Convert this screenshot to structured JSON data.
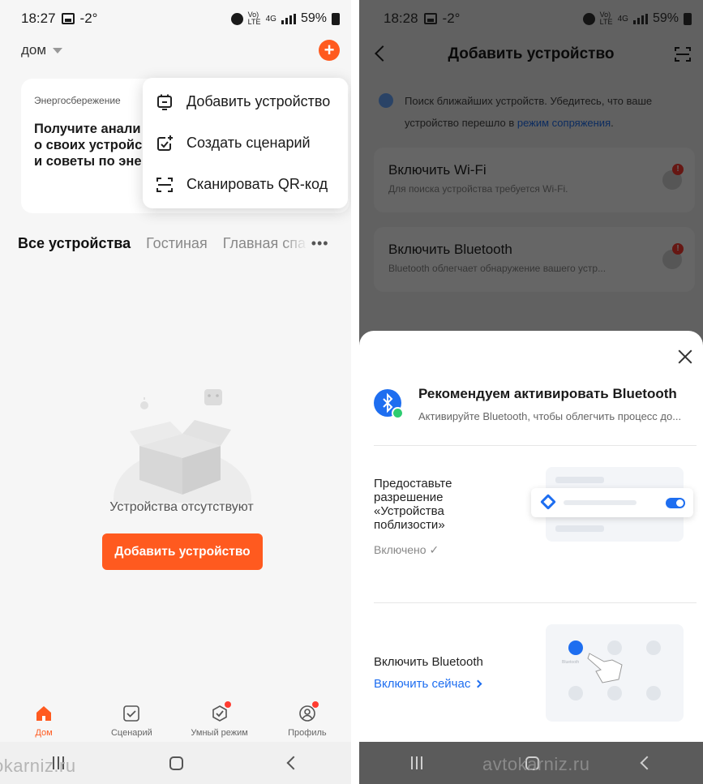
{
  "left": {
    "status": {
      "time": "18:27",
      "temp": "-2°",
      "battery": "59%",
      "net_top": "Vo)",
      "net_bottom": "LTE",
      "signal": "4G"
    },
    "home": {
      "label": "дом"
    },
    "energy_card": {
      "tag": "Энергосбережение",
      "title_lines": [
        "Получите анали",
        "о своих устройс",
        "и советы по эне"
      ]
    },
    "menu": {
      "items": [
        {
          "label": "Добавить устройство",
          "icon": "add-device-icon"
        },
        {
          "label": "Создать сценарий",
          "icon": "create-scene-icon"
        },
        {
          "label": "Сканировать QR-код",
          "icon": "qr-scan-icon"
        }
      ]
    },
    "rooms": {
      "active": "Все устройства",
      "tabs": [
        "Гостиная",
        "Главная спа"
      ],
      "more": "•••"
    },
    "empty": {
      "text": "Устройства отсутствуют",
      "button": "Добавить устройство"
    },
    "tabbar": {
      "items": [
        {
          "label": "Дом",
          "icon": "home-icon",
          "active": true,
          "badge": false
        },
        {
          "label": "Сценарий",
          "icon": "scene-icon",
          "active": false,
          "badge": false
        },
        {
          "label": "Умный режим",
          "icon": "smart-mode-icon",
          "active": false,
          "badge": true
        },
        {
          "label": "Профиль",
          "icon": "profile-icon",
          "active": false,
          "badge": true
        }
      ]
    },
    "watermark": "okarniz.ru"
  },
  "right": {
    "status": {
      "time": "18:28",
      "temp": "-2°",
      "battery": "59%",
      "net_top": "Vo)",
      "net_bottom": "LTE",
      "signal": "4G"
    },
    "nav": {
      "title": "Добавить устройство"
    },
    "search_hint": {
      "text": "Поиск ближайших устройств. Убедитесь, что ваше устройство перешло в ",
      "link": "режим сопряжения",
      "tail": "."
    },
    "steps": [
      {
        "title": "Включить Wi-Fi",
        "subtitle": "Для поиска устройства требуется Wi-Fi.",
        "icon": "wifi-icon"
      },
      {
        "title": "Включить Bluetooth",
        "subtitle": "Bluetooth облегчает обнаружение вашего устр...",
        "icon": "bluetooth-icon"
      }
    ],
    "sheet": {
      "title": "Рекомендуем активировать Bluetooth",
      "subtitle": "Активируйте Bluetooth, чтобы облегчить процесс до...",
      "permission": {
        "title_lines": [
          "Предоставьте",
          "разрешение",
          "«Устройства",
          "поблизости»"
        ],
        "status": "Включено ✓"
      },
      "bluetooth": {
        "title": "Включить Bluetooth",
        "link": "Включить сейчас"
      },
      "illus_label": "Bluetooth"
    },
    "watermark": "avtokarniz.ru"
  },
  "colors": {
    "accent": "#ff5a1f",
    "link": "#1e6ef0",
    "badge": "#ff3b30"
  }
}
